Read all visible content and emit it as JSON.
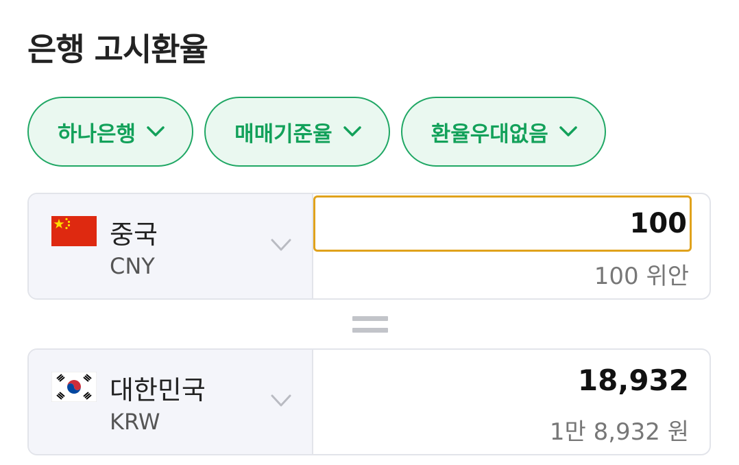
{
  "header": {
    "title": "은행 고시환율"
  },
  "filters": [
    {
      "label": "하나은행",
      "icon": "chevron-down-icon"
    },
    {
      "label": "매매기준율",
      "icon": "chevron-down-icon"
    },
    {
      "label": "환율우대없음",
      "icon": "chevron-down-icon"
    }
  ],
  "from_currency": {
    "country": "중국",
    "code": "CNY",
    "flag_icon": "china-flag-icon",
    "amount_value": "100",
    "amount_words": "100 위안"
  },
  "to_currency": {
    "country": "대한민국",
    "code": "KRW",
    "flag_icon": "korea-flag-icon",
    "amount_value": "18,932",
    "amount_words": "1만 8,932 원"
  },
  "colors": {
    "accent_green": "#13a15a",
    "chip_background": "#eaf8f0",
    "input_focus_border": "#e0a21c"
  }
}
